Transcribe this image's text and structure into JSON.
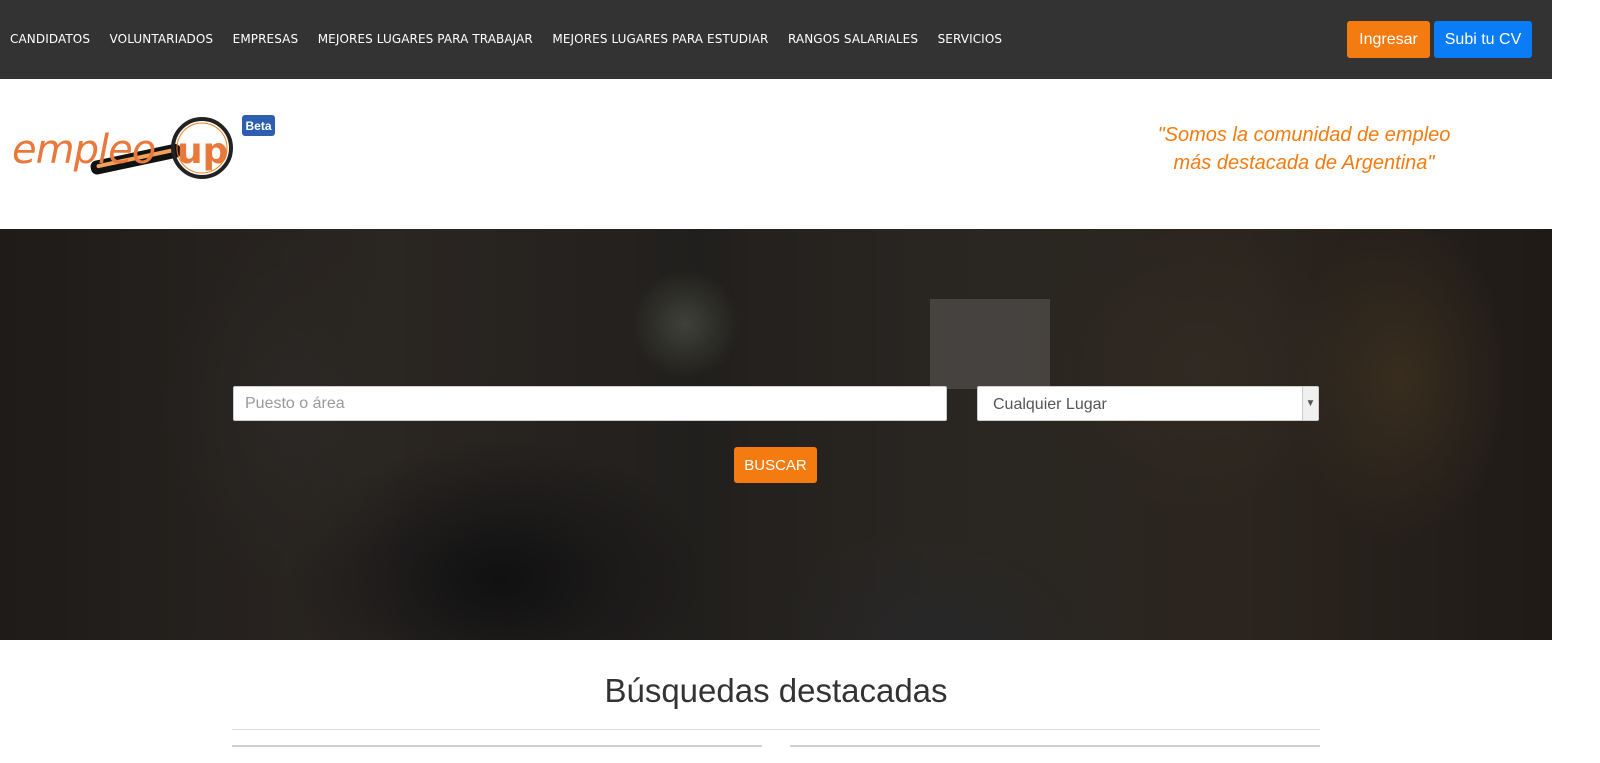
{
  "nav": {
    "items": [
      "CANDIDATOS",
      "VOLUNTARIADOS",
      "EMPRESAS",
      "MEJORES LUGARES PARA TRABAJAR",
      "MEJORES LUGARES PARA ESTUDIAR",
      "RANGOS SALARIALES",
      "SERVICIOS"
    ],
    "login_label": "Ingresar",
    "upload_cv_label": "Subi tu CV"
  },
  "brand": {
    "logo_text_main": "empleo",
    "logo_text_accent": "up",
    "beta_label": "Beta",
    "slogan_line1": "\"Somos la comunidad de empleo",
    "slogan_line2": "más destacada de Argentina\""
  },
  "search": {
    "keyword_placeholder": "Puesto o área",
    "location_value": "Cualquier Lugar",
    "submit_label": "BUSCAR"
  },
  "featured": {
    "title": "Búsquedas destacadas"
  },
  "colors": {
    "topbar": "#333333",
    "accent_orange": "#f47b0f",
    "accent_blue": "#0a7cf5",
    "beta_blue": "#2d5fae"
  }
}
